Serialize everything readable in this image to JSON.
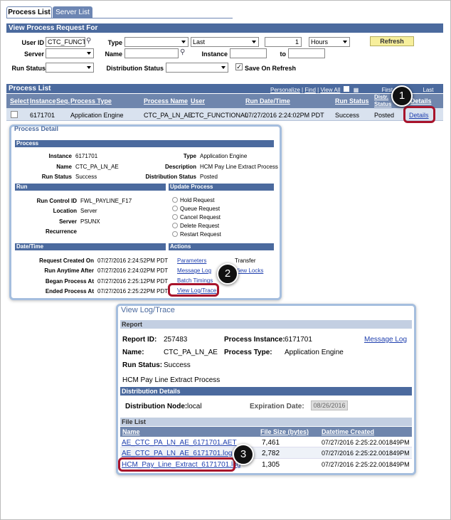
{
  "tabs": {
    "process_list": "Process List",
    "server_list": "Server List"
  },
  "filter": {
    "title": "View Process Request For",
    "user_id_label": "User ID",
    "user_id_value": "CTC_FUNCTIC",
    "type_label": "Type",
    "last_label": "Last",
    "count_value": "1",
    "unit_value": "Hours",
    "refresh": "Refresh",
    "server_label": "Server",
    "name_label": "Name",
    "instance_label": "Instance",
    "to_label": "to",
    "run_status_label": "Run Status",
    "dist_status_label": "Distribution Status",
    "save_on_refresh": "Save On Refresh"
  },
  "process_list": {
    "title": "Process List",
    "personalize": "Personalize",
    "find": "Find",
    "view_all": "View All",
    "first": "First",
    "last": "Last",
    "columns": [
      "Select",
      "Instance",
      "Seq.",
      "Process Type",
      "Process Name",
      "User",
      "Run Date/Time",
      "Run Status",
      "Distr. Status",
      "Details"
    ],
    "row": {
      "instance": "6171701",
      "process_type": "Application Engine",
      "process_name": "CTC_PA_LN_AE",
      "user": "CTC_FUNCTIONAL",
      "run_date": "07/27/2016  2:24:02PM PDT",
      "run_status": "Success",
      "distr_status": "Posted",
      "details": "Details"
    }
  },
  "process_detail": {
    "title": "Process Detail",
    "process": {
      "header": "Process",
      "instance_label": "Instance",
      "instance": "6171701",
      "name_label": "Name",
      "name": "CTC_PA_LN_AE",
      "run_status_label": "Run Status",
      "run_status": "Success",
      "type_label": "Type",
      "type": "Application Engine",
      "description_label": "Description",
      "description": "HCM Pay Line Extract Process",
      "dist_status_label": "Distribution Status",
      "dist_status": "Posted"
    },
    "run": {
      "header": "Run",
      "run_control_label": "Run Control ID",
      "run_control": "FWL_PAYLINE_F17",
      "location_label": "Location",
      "location": "Server",
      "server_label": "Server",
      "server": "PSUNX",
      "recurrence_label": "Recurrence"
    },
    "update": {
      "header": "Update Process",
      "options": [
        "Hold Request",
        "Queue Request",
        "Cancel Request",
        "Delete Request",
        "Restart Request"
      ]
    },
    "datetime": {
      "header": "Date/Time",
      "created_label": "Request Created On",
      "created": "07/27/2016  2:24:52PM PDT",
      "anytime_label": "Run Anytime After",
      "anytime": "07/27/2016  2:24:02PM PDT",
      "began_label": "Began Process At",
      "began": "07/27/2016  2:25:12PM PDT",
      "ended_label": "Ended Process At",
      "ended": "07/27/2016  2:25:22PM PDT"
    },
    "actions": {
      "header": "Actions",
      "parameters": "Parameters",
      "transfer": "Transfer",
      "message_log": "Message Log",
      "view_locks": "View Locks",
      "batch_timings": "Batch Timings",
      "view_log": "View Log/Trace"
    }
  },
  "log": {
    "title": "View Log/Trace",
    "report_header": "Report",
    "report_id_label": "Report ID:",
    "report_id": "257483",
    "instance_label": "Process Instance:",
    "instance": "6171701",
    "message_log": "Message Log",
    "name_label": "Name:",
    "name": "CTC_PA_LN_AE",
    "type_label": "Process Type:",
    "type": "Application Engine",
    "status_label": "Run Status:",
    "status": "Success",
    "description": "HCM Pay Line Extract Process",
    "dist_header": "Distribution Details",
    "node_label": "Distribution Node:",
    "node": "local",
    "expiration_label": "Expiration Date:",
    "expiration": "08/26/2016",
    "file_header": "File List",
    "col_name": "Name",
    "col_size": "File Size (bytes)",
    "col_date": "Datetime Created",
    "files": [
      {
        "name": "AE_CTC_PA_LN_AE_6171701.AET",
        "size": "7,461",
        "date": "07/27/2016  2:25:22.001849PM"
      },
      {
        "name": "AE_CTC_PA_LN_AE_6171701.log",
        "size": "2,782",
        "date": "07/27/2016  2:25:22.001849PM"
      },
      {
        "name": "HCM_Pay_Line_Extract_6171701.log",
        "size": "1,305",
        "date": "07/27/2016  2:25:22.001849PM"
      }
    ]
  },
  "callouts": [
    "1",
    "2",
    "3"
  ]
}
